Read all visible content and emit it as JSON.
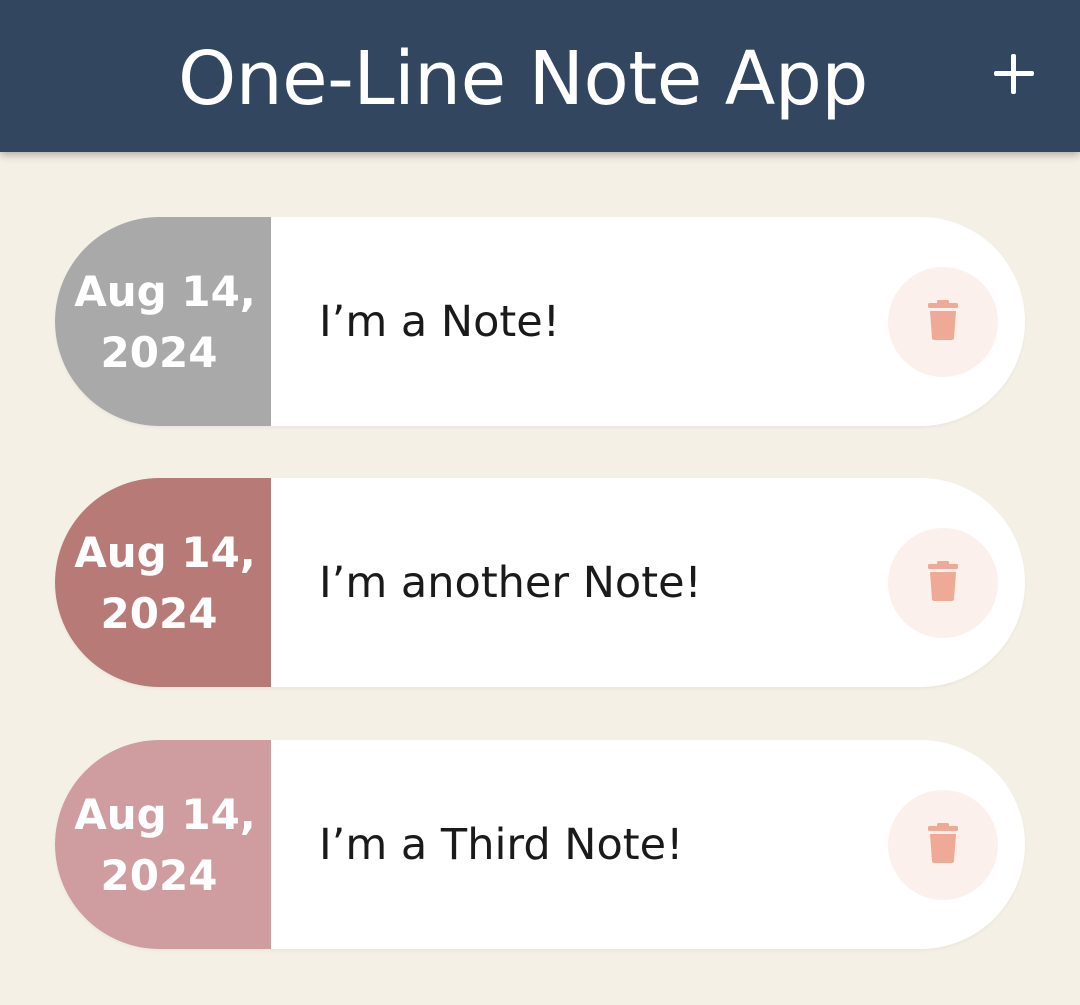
{
  "header": {
    "title": "One-Line Note App",
    "add_label": "+"
  },
  "notes": [
    {
      "date_line1": "Aug 14,",
      "date_line2": "2024",
      "text": "I’m a Note!",
      "color": "#a9a9a9"
    },
    {
      "date_line1": "Aug 14,",
      "date_line2": "2024",
      "text": "I’m another Note!",
      "color": "#b87a76"
    },
    {
      "date_line1": "Aug 14,",
      "date_line2": "2024",
      "text": "I’m a Third Note!",
      "color": "#cf9d9f"
    }
  ],
  "icons": {
    "add": "plus-icon",
    "delete": "trash-icon"
  },
  "colors": {
    "header_bg": "#32475f",
    "page_bg": "#f4f0e6",
    "trash": "#eeaa96",
    "delete_bg": "#fcf0ec"
  }
}
